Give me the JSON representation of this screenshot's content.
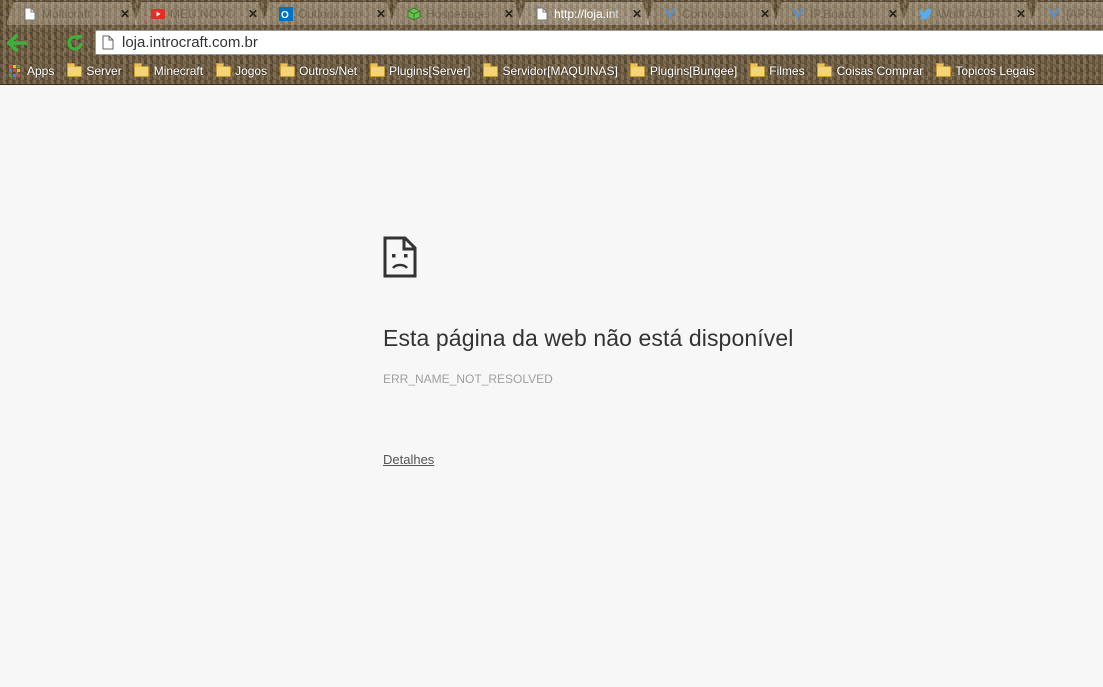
{
  "tabs": [
    {
      "title": "Multicraft - C",
      "icon": "page-icon",
      "active": false
    },
    {
      "title": "MEU NOVO",
      "icon": "youtube-icon",
      "active": false
    },
    {
      "title": "Outlook.com",
      "icon": "outlook-icon",
      "active": false
    },
    {
      "title": "Hospedagem",
      "icon": "cube-icon",
      "active": false
    },
    {
      "title": "http://loja.int",
      "icon": "page-icon",
      "active": true
    },
    {
      "title": "Como baixar",
      "icon": "ipboard-icon",
      "active": false
    },
    {
      "title": "IP.Board: Ma",
      "icon": "ipboard-icon",
      "active": false
    },
    {
      "title": "Wolff #ADR3",
      "icon": "twitter-icon",
      "active": false
    },
    {
      "title": "[APROVA",
      "icon": "ipboard-icon",
      "active": false
    }
  ],
  "toolbar": {
    "url": "loja.introcraft.com.br"
  },
  "bookmarks": [
    {
      "label": "Apps",
      "icon": "apps-icon"
    },
    {
      "label": "Server",
      "icon": "folder-icon"
    },
    {
      "label": "Minecraft",
      "icon": "folder-icon"
    },
    {
      "label": "Jogos",
      "icon": "folder-icon"
    },
    {
      "label": "Outros/Net",
      "icon": "folder-icon"
    },
    {
      "label": "Plugins[Server]",
      "icon": "folder-icon"
    },
    {
      "label": "Servidor[MAQUINAS]",
      "icon": "folder-icon"
    },
    {
      "label": "Plugins[Bungee]",
      "icon": "folder-icon"
    },
    {
      "label": "Filmes",
      "icon": "folder-icon"
    },
    {
      "label": "Coisas Comprar",
      "icon": "folder-icon"
    },
    {
      "label": "Topicos Legais",
      "icon": "folder-icon"
    }
  ],
  "error": {
    "icon": "sad-page-icon",
    "title": "Esta página da web não está disponível",
    "code": "ERR_NAME_NOT_RESOLVED",
    "details_label": "Detalhes"
  },
  "colors": {
    "page_background": "#f7f7f7",
    "nav_arrow": "#3bb33b"
  }
}
